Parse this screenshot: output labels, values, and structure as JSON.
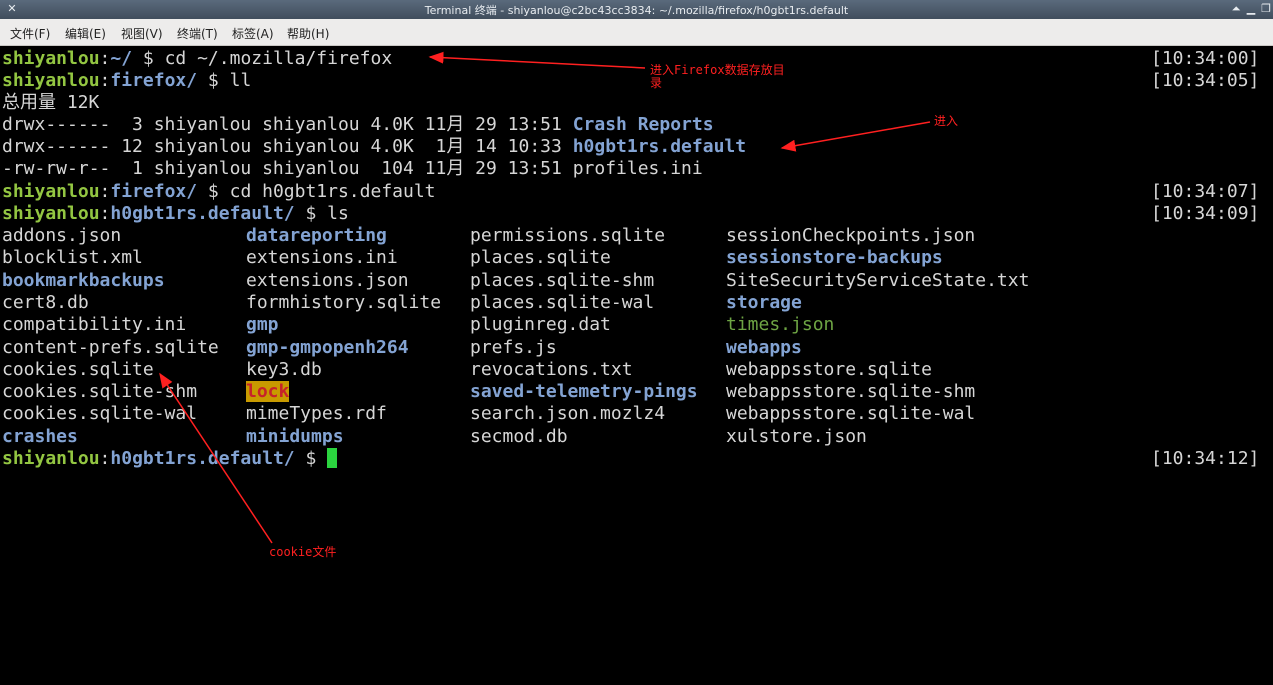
{
  "window": {
    "title": "Terminal 终端 - shiyanlou@c2bc43cc3834: ~/.mozilla/firefox/h0gbt1rs.default",
    "left_icon": "close-x-icon",
    "buttons": [
      "shade-up-icon",
      "minimize-icon",
      "restore-icon"
    ]
  },
  "menu": [
    "文件(F)",
    "编辑(E)",
    "视图(V)",
    "终端(T)",
    "标签(A)",
    "帮助(H)"
  ],
  "prompt_user": "shiyanlou",
  "lines": {
    "l1": {
      "path": "~/",
      "cmd": " $ cd ~/.mozilla/firefox",
      "time": "[10:34:00]"
    },
    "l2": {
      "path": "firefox/",
      "cmd": " $ ll",
      "time": "[10:34:05]"
    },
    "l3": {
      "text": "总用量 12K"
    },
    "l4": {
      "text": "drwx------  3 shiyanlou shiyanlou 4.0K 11月 29 13:51 ",
      "name": "Crash Reports"
    },
    "l5": {
      "text": "drwx------ 12 shiyanlou shiyanlou 4.0K  1月 14 10:33 ",
      "name": "h0gbt1rs.default"
    },
    "l6": {
      "text": "-rw-rw-r--  1 shiyanlou shiyanlou  104 11月 29 13:51 ",
      "name": "profiles.ini"
    },
    "l7": {
      "path": "firefox/",
      "cmd": " $ cd h0gbt1rs.default",
      "time": "[10:34:07]"
    },
    "l8": {
      "path": "h0gbt1rs.default/",
      "cmd": " $ ls",
      "time": "[10:34:09]"
    },
    "l9": {
      "path": "h0gbt1rs.default/",
      "cmd": " $ ",
      "time": "[10:34:12]"
    }
  },
  "ls_columns": [
    [
      {
        "name": "addons.json",
        "kind": "file"
      },
      {
        "name": "blocklist.xml",
        "kind": "file"
      },
      {
        "name": "bookmarkbackups",
        "kind": "dir"
      },
      {
        "name": "cert8.db",
        "kind": "file"
      },
      {
        "name": "compatibility.ini",
        "kind": "file"
      },
      {
        "name": "content-prefs.sqlite",
        "kind": "file"
      },
      {
        "name": "cookies.sqlite",
        "kind": "file"
      },
      {
        "name": "cookies.sqlite-shm",
        "kind": "file"
      },
      {
        "name": "cookies.sqlite-wal",
        "kind": "file"
      },
      {
        "name": "crashes",
        "kind": "dir"
      }
    ],
    [
      {
        "name": "datareporting",
        "kind": "dir"
      },
      {
        "name": "extensions.ini",
        "kind": "file"
      },
      {
        "name": "extensions.json",
        "kind": "file"
      },
      {
        "name": "formhistory.sqlite",
        "kind": "file"
      },
      {
        "name": "gmp",
        "kind": "dir"
      },
      {
        "name": "gmp-gmpopenh264",
        "kind": "dir"
      },
      {
        "name": "key3.db",
        "kind": "file"
      },
      {
        "name": "lock",
        "kind": "lock"
      },
      {
        "name": "mimeTypes.rdf",
        "kind": "file"
      },
      {
        "name": "minidumps",
        "kind": "dir"
      }
    ],
    [
      {
        "name": "permissions.sqlite",
        "kind": "file"
      },
      {
        "name": "places.sqlite",
        "kind": "file"
      },
      {
        "name": "places.sqlite-shm",
        "kind": "file"
      },
      {
        "name": "places.sqlite-wal",
        "kind": "file"
      },
      {
        "name": "pluginreg.dat",
        "kind": "file"
      },
      {
        "name": "prefs.js",
        "kind": "file"
      },
      {
        "name": "revocations.txt",
        "kind": "file"
      },
      {
        "name": "saved-telemetry-pings",
        "kind": "dir"
      },
      {
        "name": "search.json.mozlz4",
        "kind": "file"
      },
      {
        "name": "secmod.db",
        "kind": "file"
      }
    ],
    [
      {
        "name": "sessionCheckpoints.json",
        "kind": "file"
      },
      {
        "name": "sessionstore-backups",
        "kind": "dir"
      },
      {
        "name": "SiteSecurityServiceState.txt",
        "kind": "file"
      },
      {
        "name": "storage",
        "kind": "dir"
      },
      {
        "name": "times.json",
        "kind": "exe"
      },
      {
        "name": "webapps",
        "kind": "dir"
      },
      {
        "name": "webappsstore.sqlite",
        "kind": "file"
      },
      {
        "name": "webappsstore.sqlite-shm",
        "kind": "file"
      },
      {
        "name": "webappsstore.sqlite-wal",
        "kind": "file"
      },
      {
        "name": "xulstore.json",
        "kind": "file"
      }
    ]
  ],
  "annotations": {
    "a1_l1": "进入Firefox数据存放目",
    "a1_l2": "录",
    "a2": "进入",
    "a3": "cookie文件",
    "color": "#ff2020"
  }
}
